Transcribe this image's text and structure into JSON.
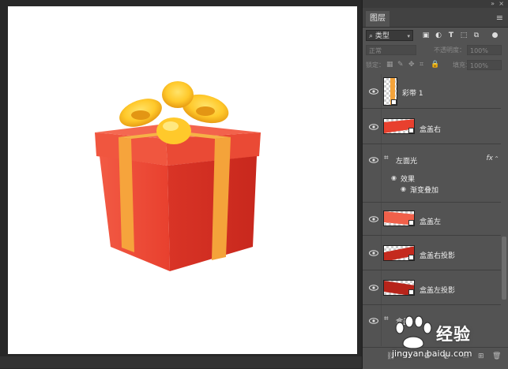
{
  "colors": {
    "box_red": "#e8402e",
    "ribbon_orange": "#f4a33a",
    "bow_yellow": "#ffc92b",
    "panel_bg": "#535353"
  },
  "panel": {
    "tab_label": "图层",
    "filter_label": "类型",
    "blend_mode": "正常",
    "opacity_label": "不透明度：",
    "opacity_value": "100%",
    "lock_label": "锁定：",
    "fill_label": "填充：",
    "fill_value": "100%"
  },
  "layers": [
    {
      "name": "彩带 1",
      "icon": "smart-object-thumbnail"
    },
    {
      "name": "盒盖右",
      "icon": "smart-object-thumbnail"
    },
    {
      "name": "左面光",
      "icon": "group-folder",
      "has_fx": true,
      "effects_label": "效果",
      "effect_name": "渐变叠加"
    },
    {
      "name": "盒盖左",
      "icon": "smart-object-thumbnail"
    },
    {
      "name": "盒盖右投影",
      "icon": "smart-object-thumbnail"
    },
    {
      "name": "盒盖左投影",
      "icon": "smart-object-thumbnail"
    },
    {
      "name": "盒盖",
      "icon": "group-folder"
    }
  ],
  "watermark": {
    "brand": "经验",
    "url": "jingyan.baidu.com"
  }
}
